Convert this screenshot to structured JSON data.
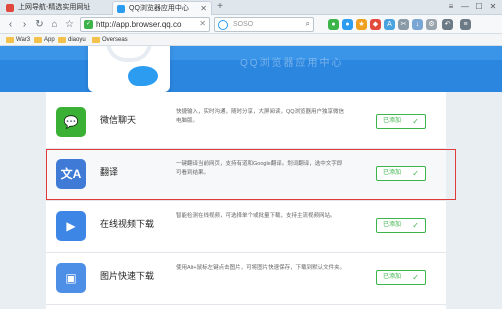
{
  "tabs": [
    {
      "label": "上网导航-精选实用网址"
    },
    {
      "label": "QQ浏览器应用中心"
    }
  ],
  "window": {
    "minimize": "—",
    "maximize": "☐",
    "close": "✕",
    "menu": "≡"
  },
  "nav": {
    "url": "http://app.browser.qq.co",
    "search_placeholder": "SOSO"
  },
  "bookmarks": [
    {
      "label": "War3"
    },
    {
      "label": "App"
    },
    {
      "label": "diaoyu"
    },
    {
      "label": "Overseas"
    }
  ],
  "banner": {
    "text": "QQ浏览器应用中心"
  },
  "apps": [
    {
      "name": "微信聊天",
      "desc": "快捷输入，实时沟通，随时分享，大屏阅读，QQ浏览器用户独享微信电脑版。",
      "status": "已添加",
      "icon": "wechat-icon",
      "color": "#3ab034"
    },
    {
      "name": "翻译",
      "desc": "一键翻译当前网页，支持有道和Google翻译。划词翻译，选中文字即可看到结果。",
      "status": "已添加",
      "icon": "translate-icon",
      "color": "#3e7ad6"
    },
    {
      "name": "在线视频下载",
      "desc": "智能检测在线视频，可选择单个或批量下载，支持主流视频网站。",
      "status": "已添加",
      "icon": "video-download-icon",
      "color": "#3d86e6"
    },
    {
      "name": "图片快速下载",
      "desc": "使用Alt+鼠标左键点击图片，可将图片快速保存，下载到默认文件夹。",
      "status": "已添加",
      "icon": "image-download-icon",
      "color": "#4d8ee6"
    }
  ]
}
